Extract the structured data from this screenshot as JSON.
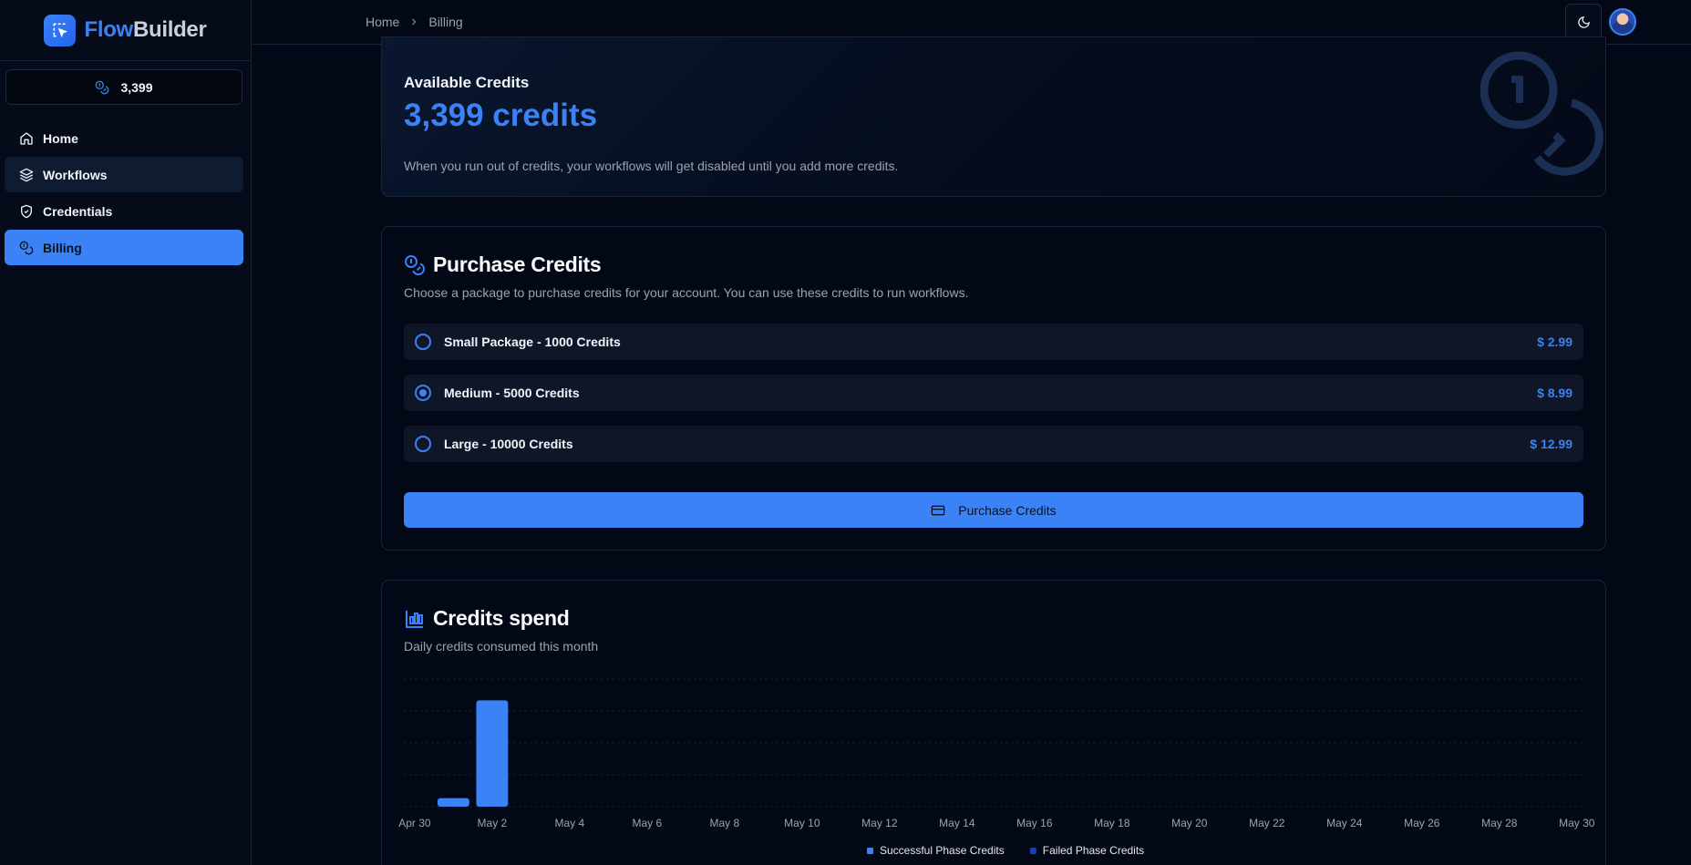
{
  "brand": {
    "name_a": "Flow",
    "name_b": "Builder"
  },
  "sidebar": {
    "credits": "3,399",
    "items": [
      {
        "label": "Home",
        "icon": "home-icon"
      },
      {
        "label": "Workflows",
        "icon": "layers-icon"
      },
      {
        "label": "Credentials",
        "icon": "shield-check-icon"
      },
      {
        "label": "Billing",
        "icon": "coins-icon"
      }
    ]
  },
  "header": {
    "breadcrumb": [
      "Home",
      "Billing"
    ],
    "theme_icon": "moon-icon"
  },
  "available": {
    "label": "Available Credits",
    "value": "3,399 credits",
    "note": "When you run out of credits, your workflows will get disabled until you add more credits."
  },
  "purchase": {
    "title": "Purchase Credits",
    "subtitle": "Choose a package to purchase credits for your account. You can use these credits to run workflows.",
    "packages": [
      {
        "label": "Small Package - 1000 Credits",
        "price": "$ 2.99",
        "selected": false
      },
      {
        "label": "Medium - 5000 Credits",
        "price": "$ 8.99",
        "selected": true
      },
      {
        "label": "Large - 10000 Credits",
        "price": "$ 12.99",
        "selected": false
      }
    ],
    "button_label": "Purchase Credits"
  },
  "spend": {
    "title": "Credits spend",
    "subtitle": "Daily credits consumed this month"
  },
  "colors": {
    "accent": "#3b82f6",
    "failed": "#1e40af",
    "bg": "#030816"
  },
  "chart_data": {
    "type": "bar",
    "x": [
      "Apr 30",
      "May 1",
      "May 2",
      "May 3",
      "May 4",
      "May 5",
      "May 6",
      "May 7",
      "May 8",
      "May 9",
      "May 10",
      "May 11",
      "May 12",
      "May 13",
      "May 14",
      "May 15",
      "May 16",
      "May 17",
      "May 18",
      "May 19",
      "May 20",
      "May 21",
      "May 22",
      "May 23",
      "May 24",
      "May 25",
      "May 26",
      "May 27",
      "May 28",
      "May 29",
      "May 30"
    ],
    "tick_labels": [
      "Apr 30",
      "May 2",
      "May 4",
      "May 6",
      "May 8",
      "May 10",
      "May 12",
      "May 14",
      "May 16",
      "May 18",
      "May 20",
      "May 22",
      "May 24",
      "May 26",
      "May 28",
      "May 30"
    ],
    "series": [
      {
        "name": "Successful Phase Credits",
        "values": [
          0,
          8,
          100,
          0,
          0,
          0,
          0,
          0,
          0,
          0,
          0,
          0,
          0,
          0,
          0,
          0,
          0,
          0,
          0,
          0,
          0,
          0,
          0,
          0,
          0,
          0,
          0,
          0,
          0,
          0,
          0
        ],
        "color": "#3b82f6"
      },
      {
        "name": "Failed Phase Credits",
        "values": [
          0,
          0,
          0,
          0,
          0,
          0,
          0,
          0,
          0,
          0,
          0,
          0,
          0,
          0,
          0,
          0,
          0,
          0,
          0,
          0,
          0,
          0,
          0,
          0,
          0,
          0,
          0,
          0,
          0,
          0,
          0
        ],
        "color": "#1e40af"
      }
    ],
    "stacked": true,
    "ylim": [
      0,
      120
    ],
    "grid": true,
    "legend": "bottom-center"
  }
}
